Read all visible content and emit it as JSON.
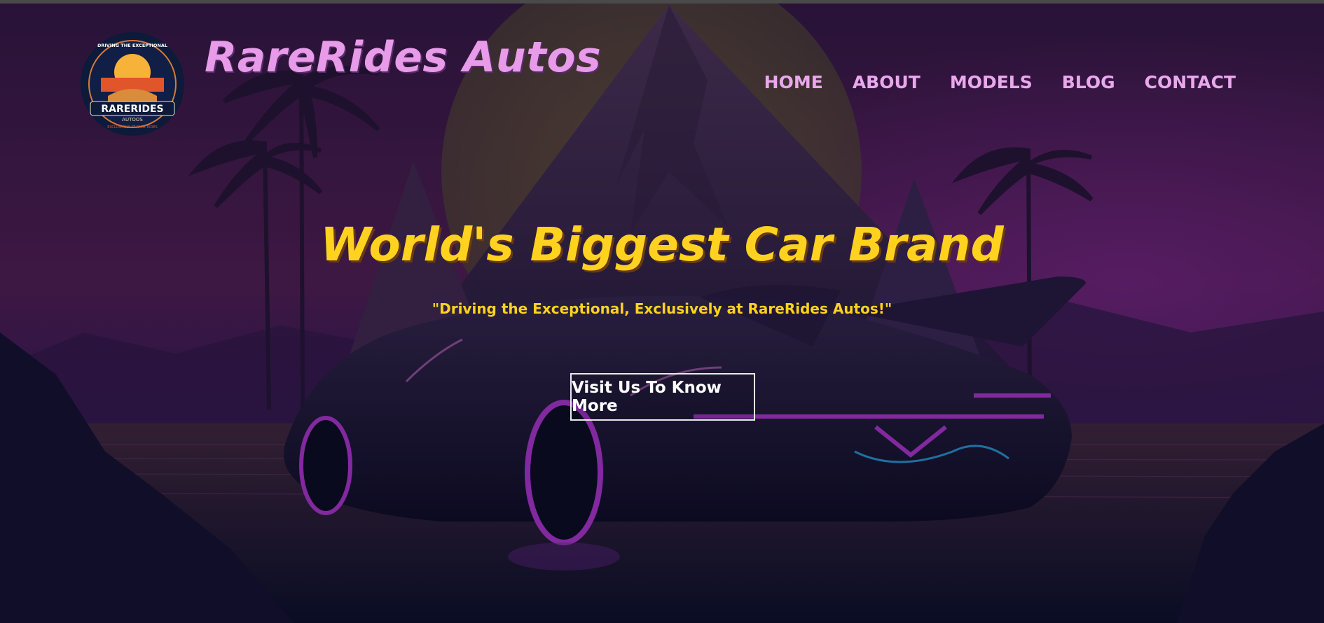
{
  "header": {
    "brand_name": "RareRides Autos",
    "logo": {
      "top_text": "DRIVING THE EXCEPTIONAL",
      "main_text": "RARERIDES",
      "sub_text": "AUTOOS",
      "bottom_text": "EXCLUSIVELY AT RARE RIDES"
    },
    "nav": [
      "HOME",
      "ABOUT",
      "MODELS",
      "BLOG",
      "CONTACT"
    ]
  },
  "hero": {
    "headline": "World's Biggest Car Brand",
    "tagline": "\"Driving the Exceptional, Exclusively at RareRides Autos!\"",
    "cta_label": "Visit Us To Know More"
  },
  "colors": {
    "brand_pink": "#e79be8",
    "headline_yellow": "#ffd21f",
    "neon_magenta": "#c43adf",
    "neon_cyan": "#2aa8e0"
  },
  "icons": [
    "logo-emblem",
    "palm-tree-icon",
    "mountain",
    "sports-car"
  ]
}
